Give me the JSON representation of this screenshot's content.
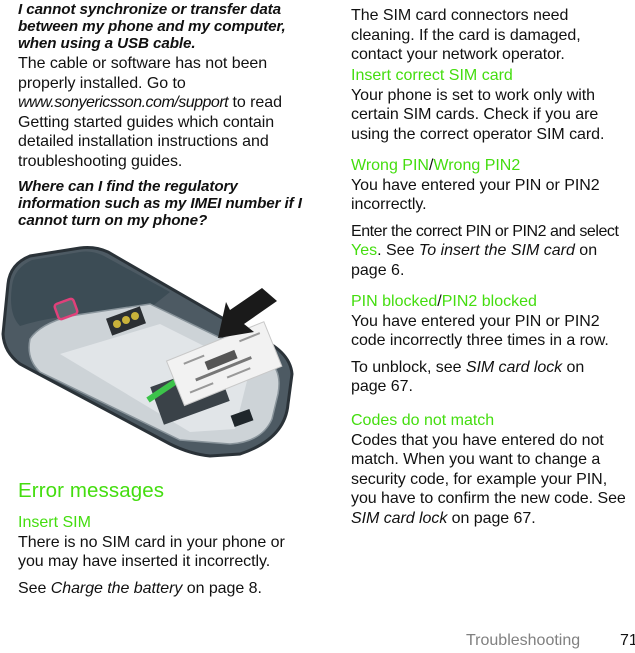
{
  "left_column": {
    "q1": {
      "question": "I cannot synchronize or transfer data between my phone and my computer, when using a USB cable.",
      "answer_part1": "The cable or software has not been properly installed. Go to",
      "link": "www.sonyericsson.com/support",
      "answer_part2": " to read Getting started guides which contain detailed installation instructions and troubleshooting guides."
    },
    "q2": {
      "question": "Where can I find the regulatory information such as my IMEI number if I cannot turn on my phone?"
    },
    "figure": {
      "description": "phone-back-with-battery-removed-label-arrow"
    },
    "section_heading": "Error messages",
    "insert_sim": {
      "title": "Insert SIM",
      "text": "There is no SIM card in your phone or you may have inserted it incorrectly.",
      "see_prefix": "See ",
      "see_ref": "Charge the battery",
      "see_suffix": " on page 8."
    }
  },
  "right_column": {
    "continued_text": "The SIM card connectors need cleaning. If the card is damaged, contact your network operator.",
    "insert_correct": {
      "title": "Insert correct SIM card",
      "text": "Your phone is set to work only with certain SIM cards. Check if you are using the correct operator SIM card."
    },
    "wrong_pin": {
      "title_a": "Wrong PIN",
      "separator": "/",
      "title_b": "Wrong PIN2",
      "text": "You have entered your PIN or PIN2 incorrectly.",
      "instr_prefix": "Enter the correct PIN or PIN2 and select ",
      "instr_key": "Yes",
      "instr_mid": ". See ",
      "instr_ref": "To insert the SIM card",
      "instr_suffix": " on page 6."
    },
    "pin_blocked": {
      "title_a": "PIN blocked",
      "separator": "/",
      "title_b": "PIN2 blocked",
      "text": "You have entered your PIN or PIN2 code incorrectly three times in a row.",
      "unblock_prefix": "To unblock, see ",
      "unblock_ref": "SIM card lock",
      "unblock_suffix": " on page 67."
    },
    "codes_mismatch": {
      "title": "Codes do not match",
      "text": "Codes that you have entered do not match. When you want to change a security code, for example your PIN, you have to confirm the new code. See ",
      "ref": "SIM card lock",
      "suffix": " on page 67."
    }
  },
  "footer": {
    "section": "Troubleshooting",
    "page_number": "71"
  },
  "colors": {
    "accent_green": "#44dd0f",
    "footer_gray": "#808080"
  }
}
